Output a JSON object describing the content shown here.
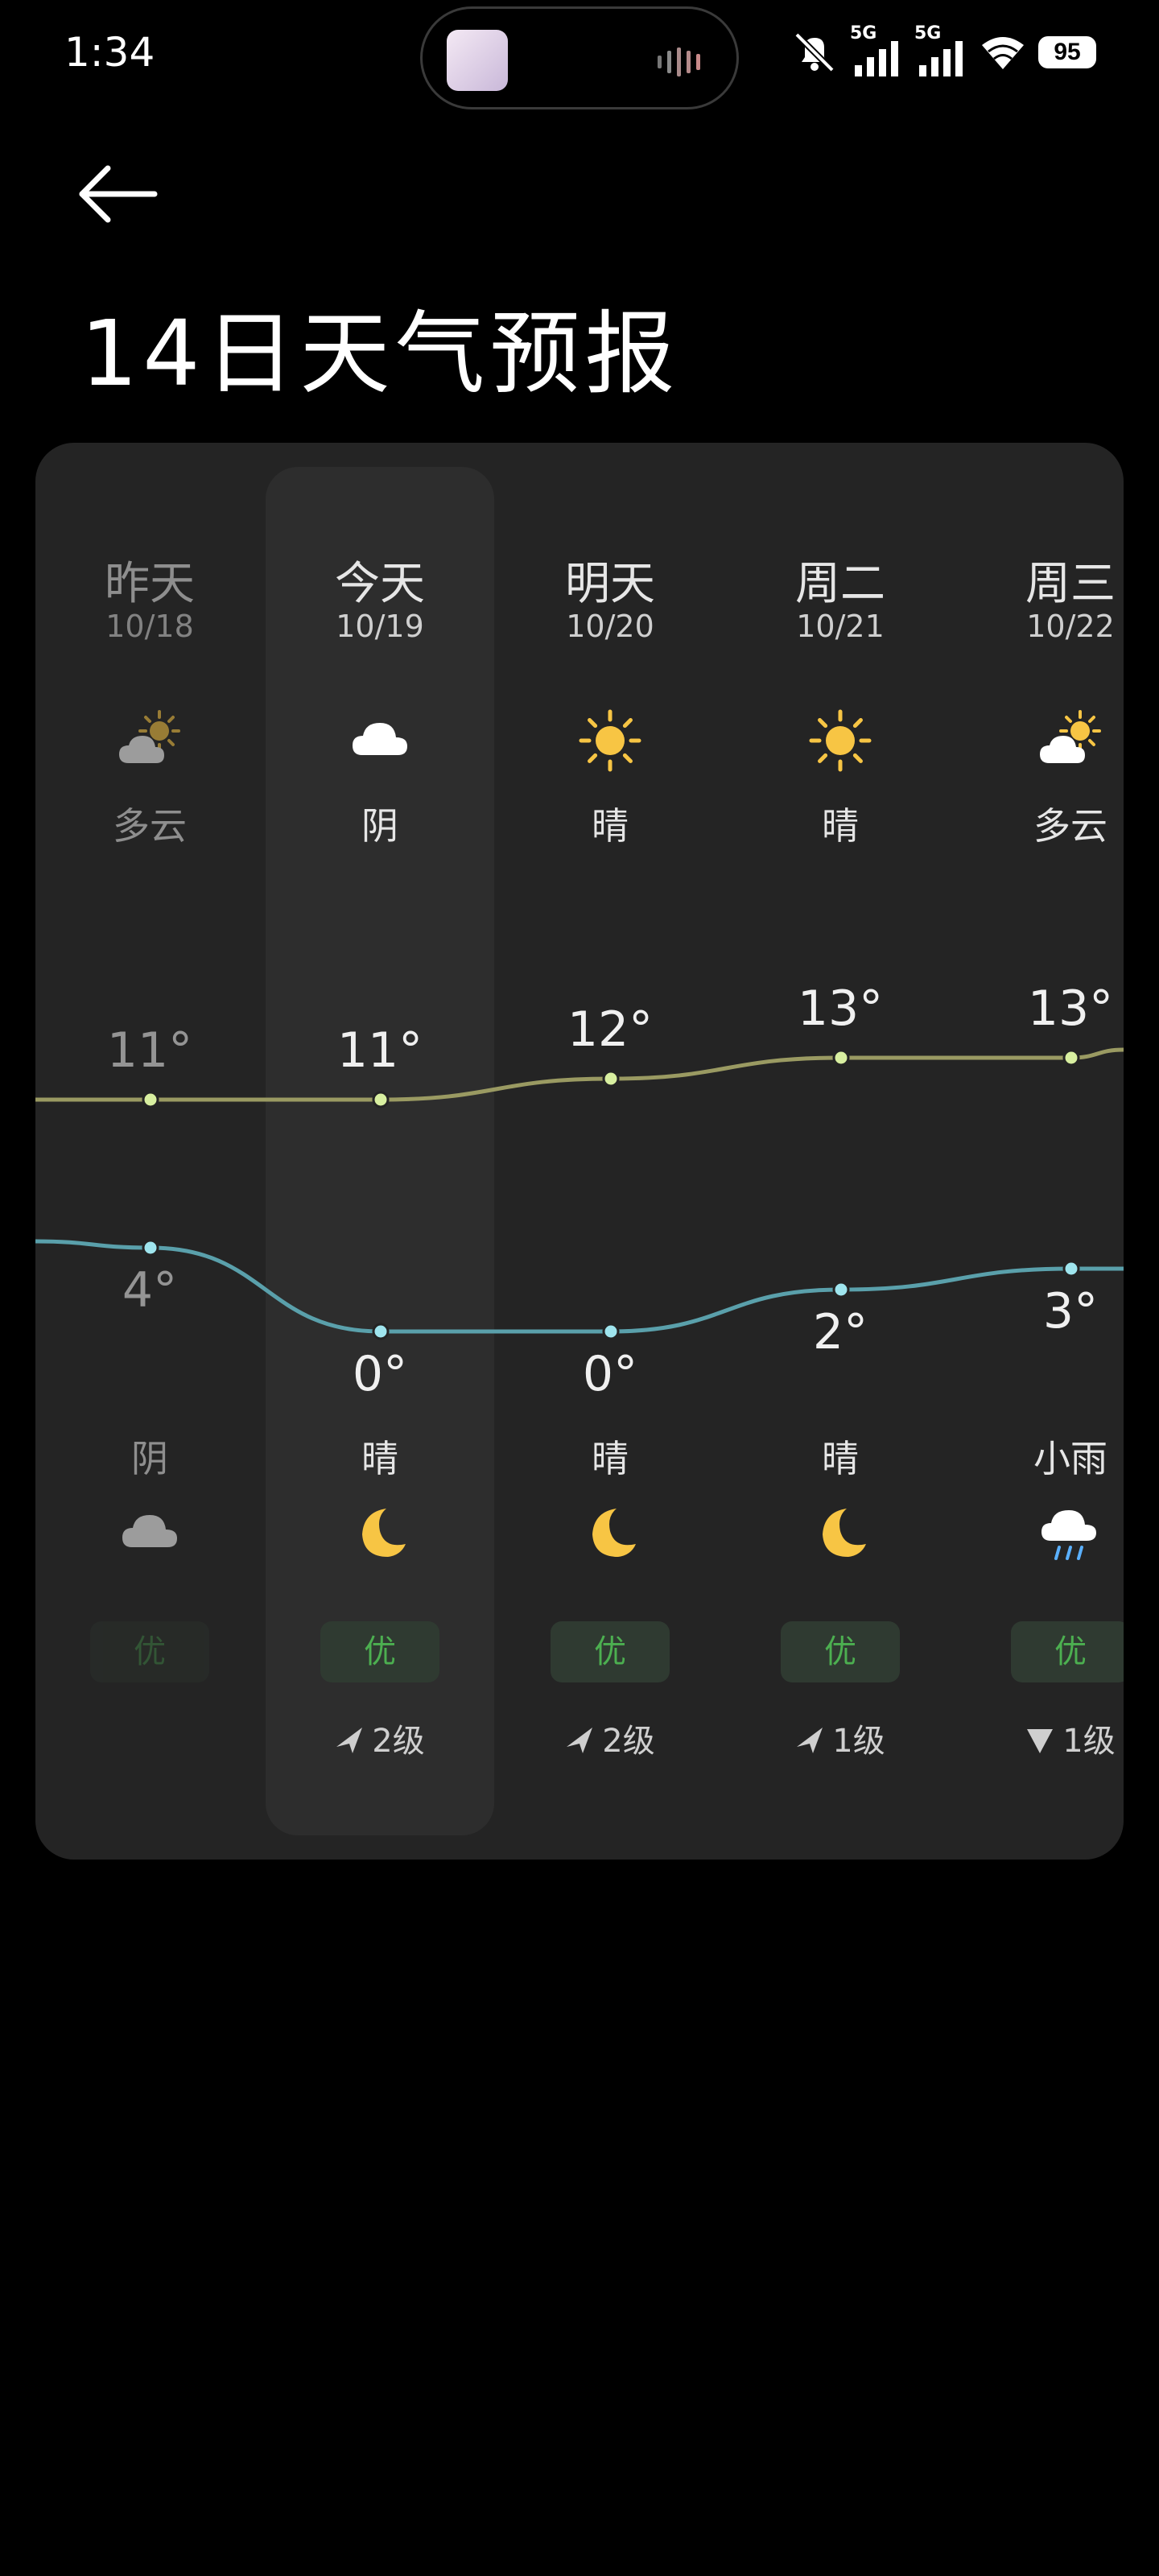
{
  "status_bar": {
    "time": "1:34",
    "network_labels": [
      "5G",
      "5G"
    ],
    "battery": "95"
  },
  "header": {
    "title": "14日天气预报"
  },
  "days": [
    {
      "name": "昨天",
      "date": "10/18",
      "day_weather": "多云",
      "day_icon": "partly-cloudy-icon",
      "high": "11°",
      "low": "4°",
      "night_weather": "阴",
      "night_icon": "cloud-icon",
      "aqi": "优",
      "wind": "",
      "wind_dir_icon": ""
    },
    {
      "name": "今天",
      "date": "10/19",
      "day_weather": "阴",
      "day_icon": "cloud-icon",
      "high": "11°",
      "low": "0°",
      "night_weather": "晴",
      "night_icon": "moon-icon",
      "aqi": "优",
      "wind": "2级",
      "wind_dir_icon": "northeast-arrow-icon"
    },
    {
      "name": "明天",
      "date": "10/20",
      "day_weather": "晴",
      "day_icon": "sun-icon",
      "high": "12°",
      "low": "0°",
      "night_weather": "晴",
      "night_icon": "moon-icon",
      "aqi": "优",
      "wind": "2级",
      "wind_dir_icon": "northeast-arrow-icon"
    },
    {
      "name": "周二",
      "date": "10/21",
      "day_weather": "晴",
      "day_icon": "sun-icon",
      "high": "13°",
      "low": "2°",
      "night_weather": "晴",
      "night_icon": "moon-icon",
      "aqi": "优",
      "wind": "1级",
      "wind_dir_icon": "northeast-arrow-icon"
    },
    {
      "name": "周三",
      "date": "10/22",
      "day_weather": "多云",
      "day_icon": "partly-cloudy-icon",
      "high": "13°",
      "low": "3°",
      "night_weather": "小雨",
      "night_icon": "rain-icon",
      "aqi": "优",
      "wind": "1级",
      "wind_dir_icon": "south-arrow-icon"
    }
  ],
  "temps": {
    "highs": [
      11,
      11,
      12,
      13,
      13
    ],
    "lows": [
      4,
      0,
      0,
      2,
      3
    ],
    "high_color": "#9a9a62",
    "low_color": "#5aa0ab",
    "high_dot": "#d8efa0",
    "low_dot": "#9fe5ee"
  },
  "colors": {
    "sun": "#f7c544",
    "moon": "#f7c544",
    "cloud": "#ffffff",
    "aqi_good": "#4caf50",
    "card_bg": "#242424"
  }
}
